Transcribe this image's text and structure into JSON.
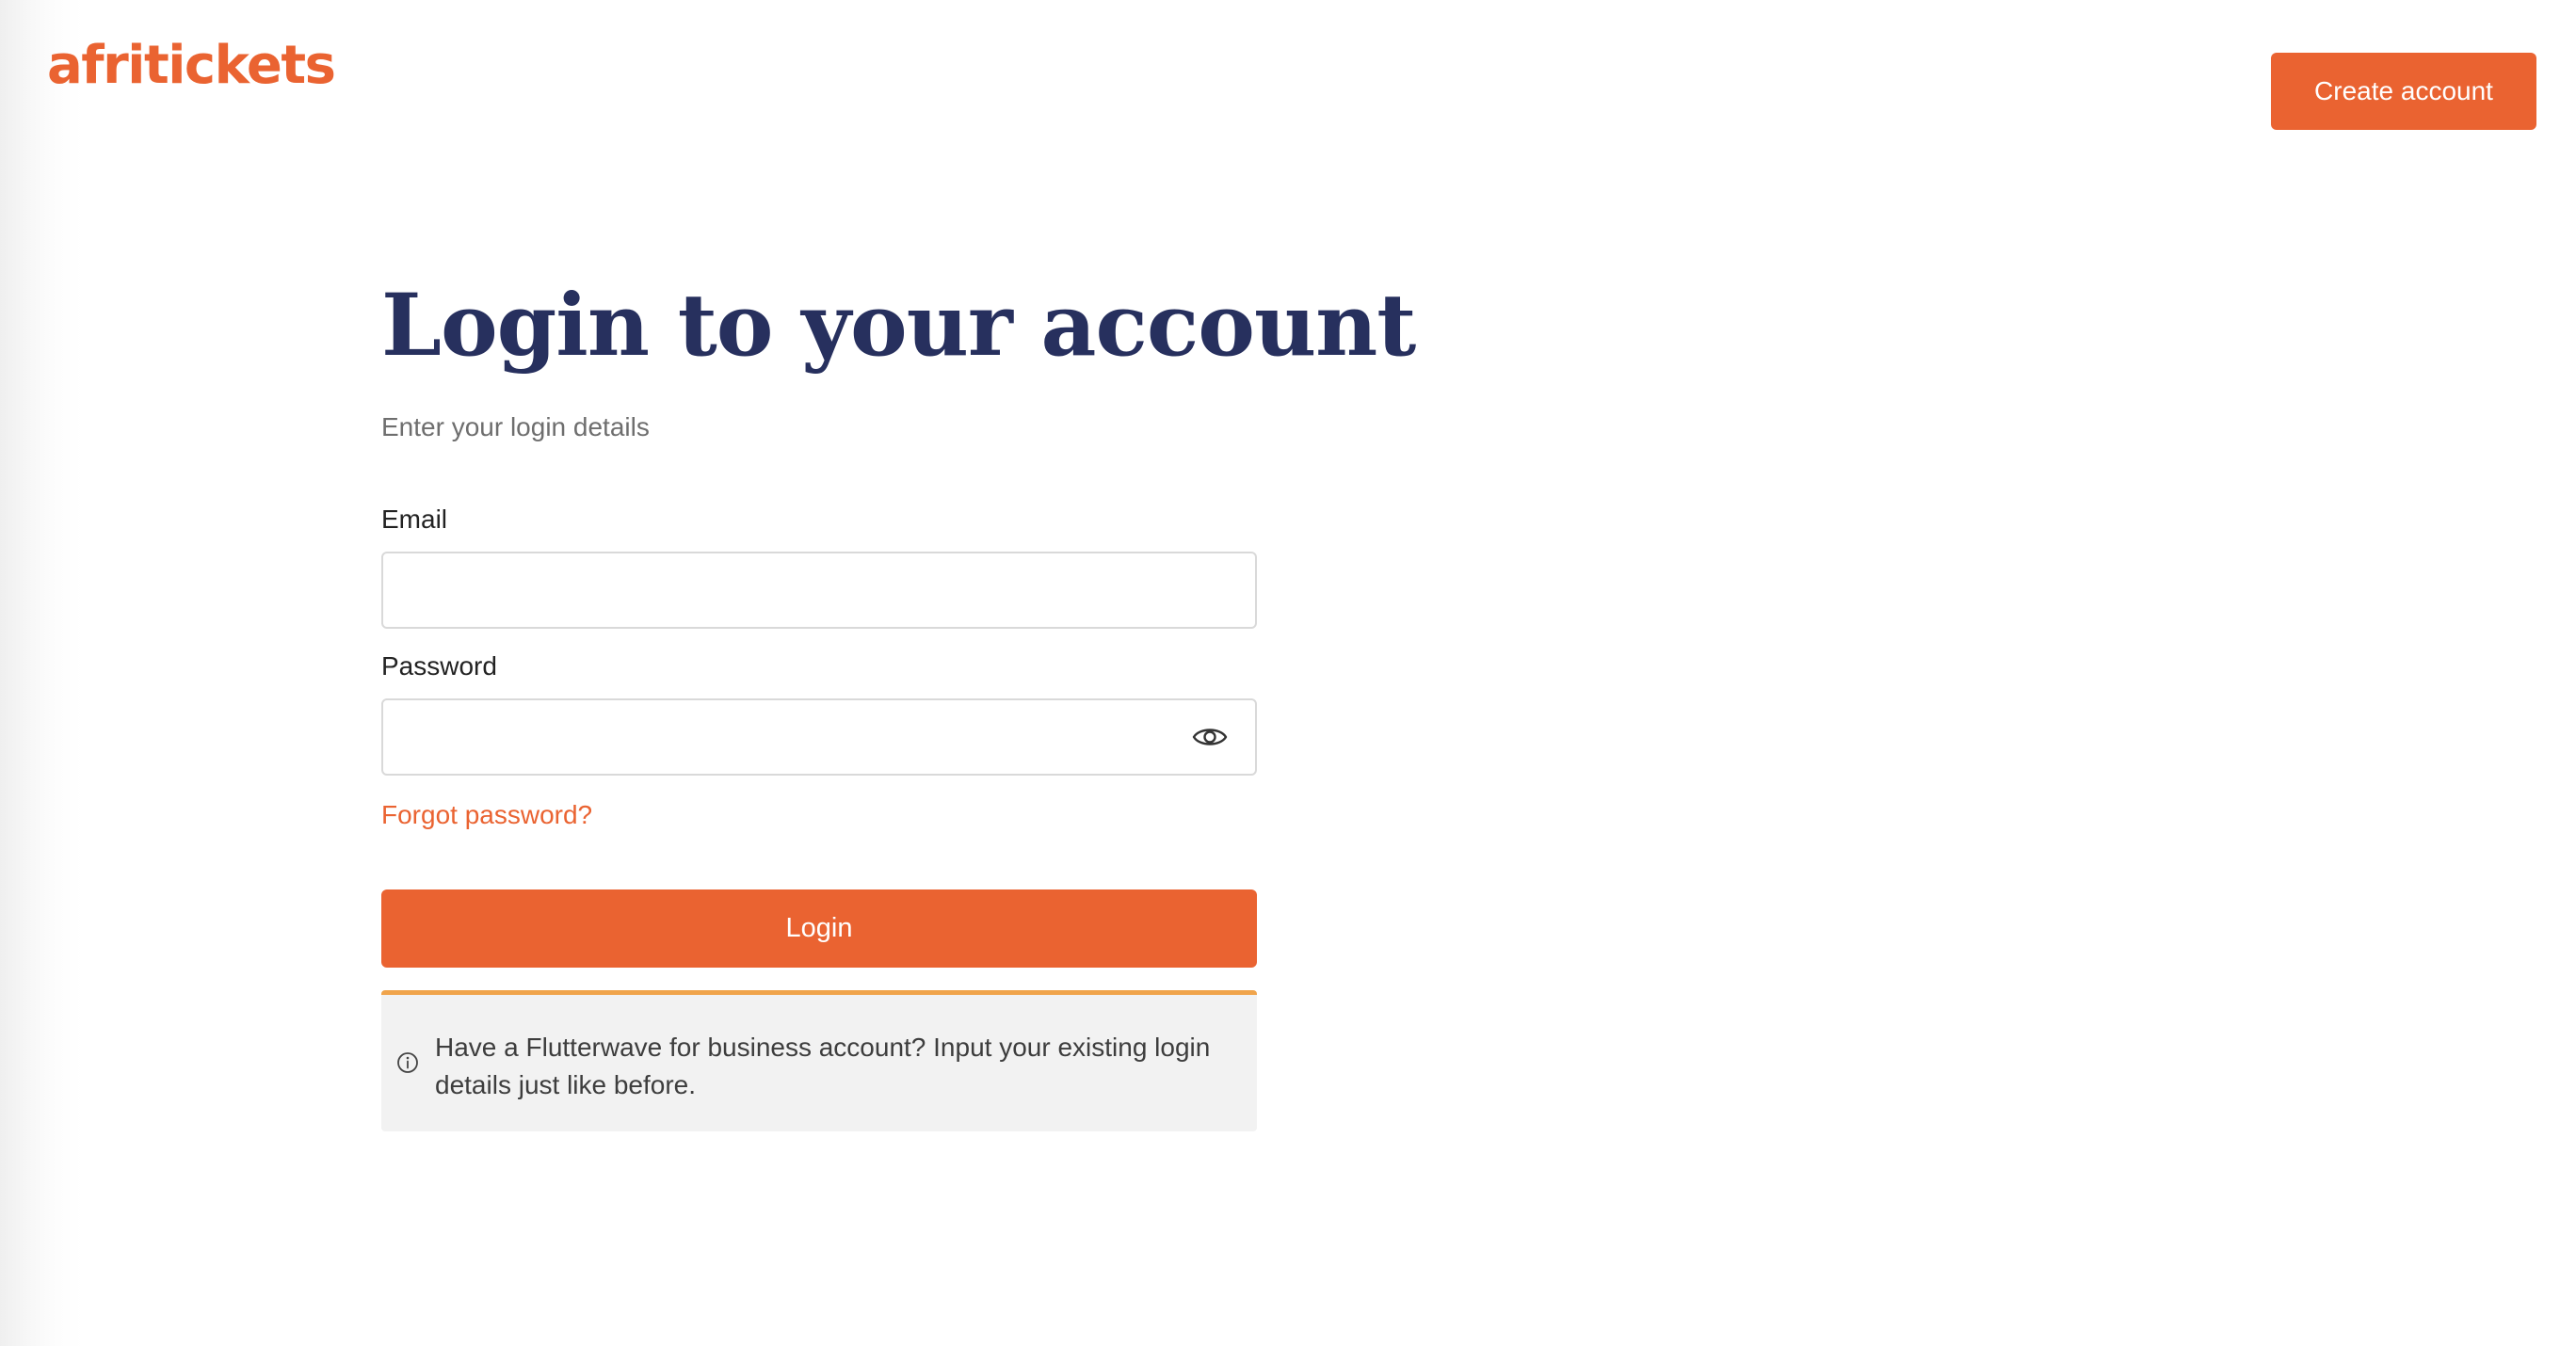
{
  "header": {
    "logo_text": "afritickets",
    "create_account_label": "Create account"
  },
  "form": {
    "title": "Login to your account",
    "subtitle": "Enter your login details",
    "email_label": "Email",
    "email_value": "",
    "password_label": "Password",
    "password_value": "",
    "forgot_label": "Forgot password?",
    "login_label": "Login"
  },
  "notice": {
    "icon": "info-circle-icon",
    "message": "Have a Flutterwave for business account? Input your existing login details just like before."
  },
  "icons": {
    "password_toggle": "eye-icon"
  },
  "colors": {
    "brand": "#ea6331",
    "title": "#27305e",
    "notice_accent": "#f0a44b",
    "notice_bg": "#f2f2f2"
  }
}
